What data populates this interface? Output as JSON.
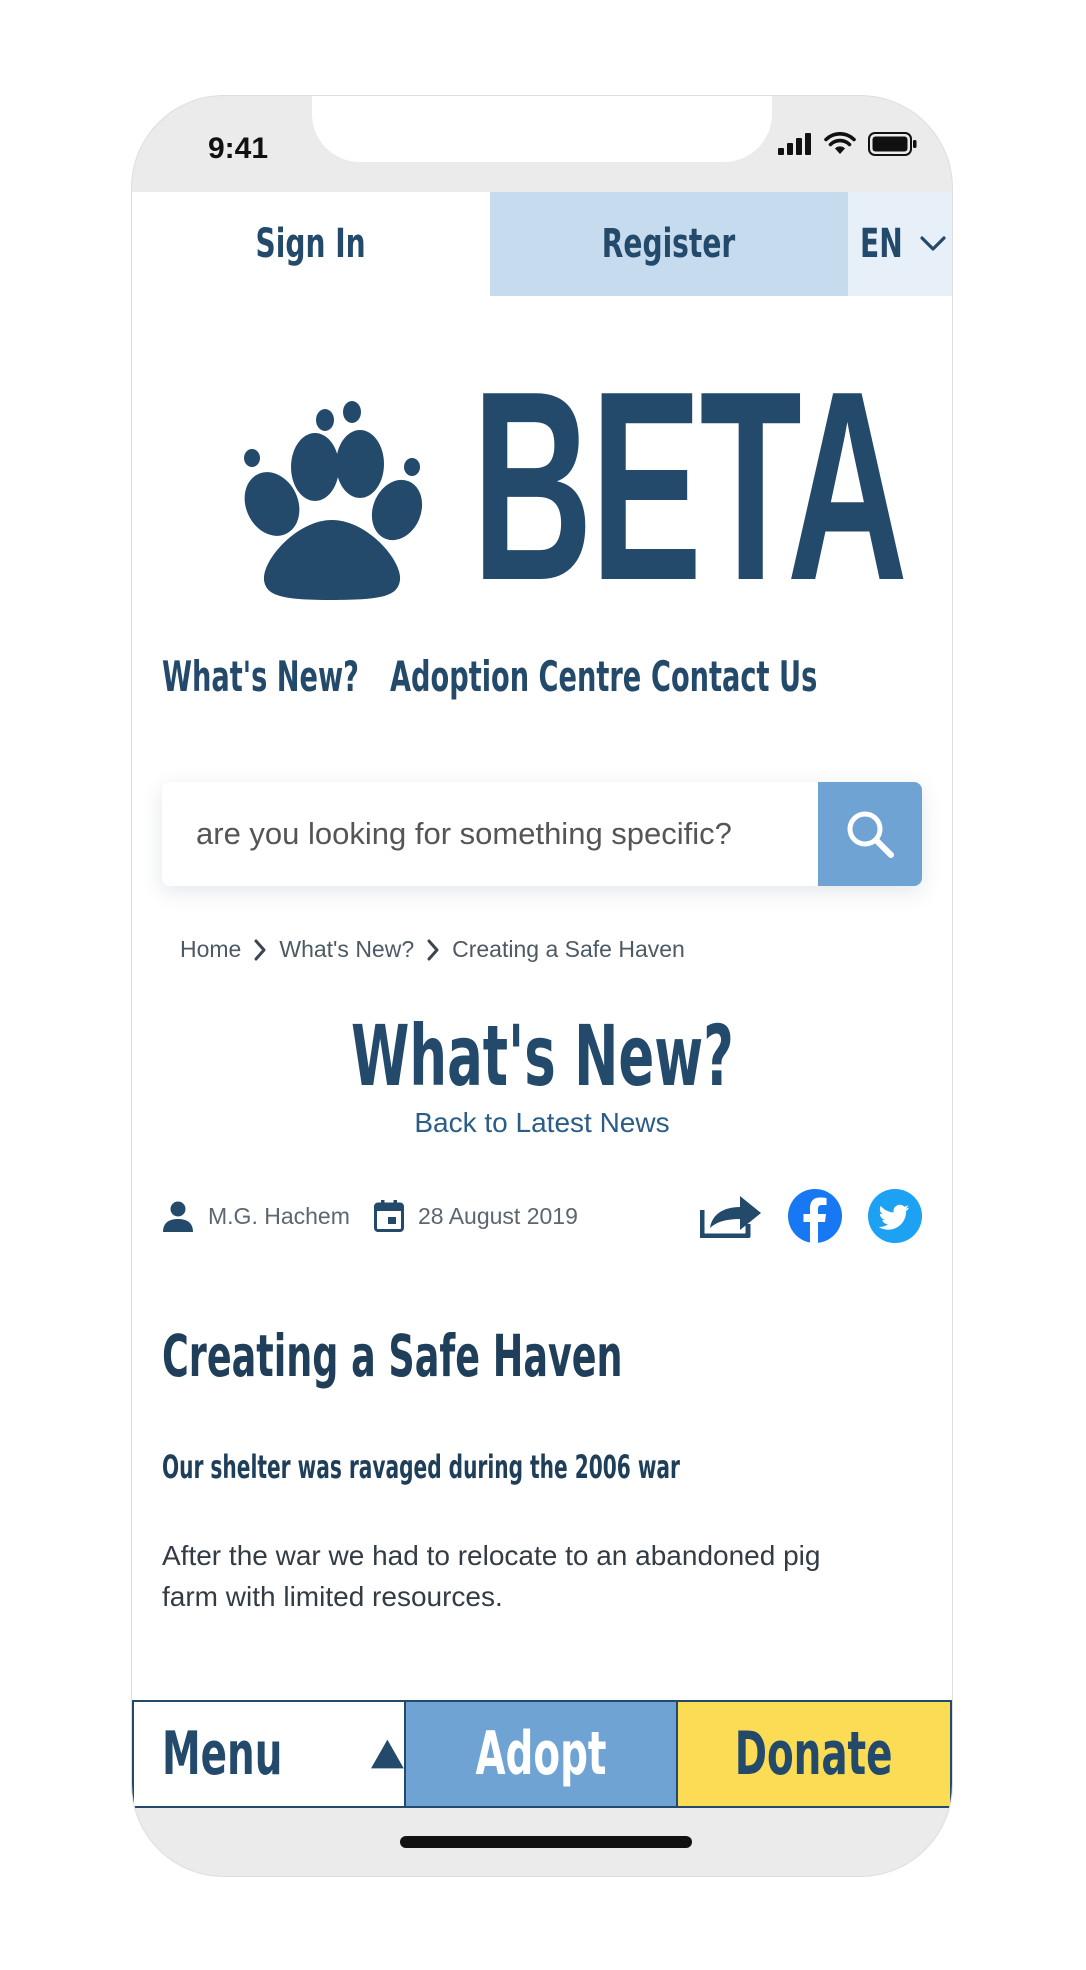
{
  "status_bar": {
    "time": "9:41"
  },
  "topbar": {
    "signin_label": "Sign In",
    "register_label": "Register",
    "language": "EN"
  },
  "logo": {
    "text": "BETA",
    "icon": "paw-icon"
  },
  "nav": {
    "items": [
      {
        "label": "What's New?"
      },
      {
        "label": "Adoption Centre"
      },
      {
        "label": "Contact Us"
      }
    ]
  },
  "search": {
    "placeholder": "are you looking for something specific?",
    "icon": "search-icon"
  },
  "breadcrumb": {
    "items": [
      {
        "label": "Home"
      },
      {
        "label": "What's New?"
      },
      {
        "label": "Creating a Safe Haven"
      }
    ]
  },
  "page": {
    "title": "What's New?",
    "back_link": "Back to Latest News"
  },
  "article": {
    "author": "M.G. Hachem",
    "date": "28 August 2019",
    "title": "Creating a Safe Haven",
    "subtitle": "Our shelter was ravaged during the 2006 war",
    "body": "After the war we had to relocate to an abandoned pig farm with limited resources."
  },
  "share": {
    "icons": [
      "share-icon",
      "facebook-icon",
      "twitter-icon"
    ]
  },
  "bottom_bar": {
    "menu_label": "Menu",
    "adopt_label": "Adopt",
    "donate_label": "Donate"
  },
  "colors": {
    "navy": "#244a6b",
    "light_blue": "#c6dbee",
    "pale_blue": "#e7f0f9",
    "mid_blue": "#6fa3d4",
    "yellow": "#fcdc55",
    "facebook": "#1877f2",
    "twitter": "#1da1f2"
  }
}
